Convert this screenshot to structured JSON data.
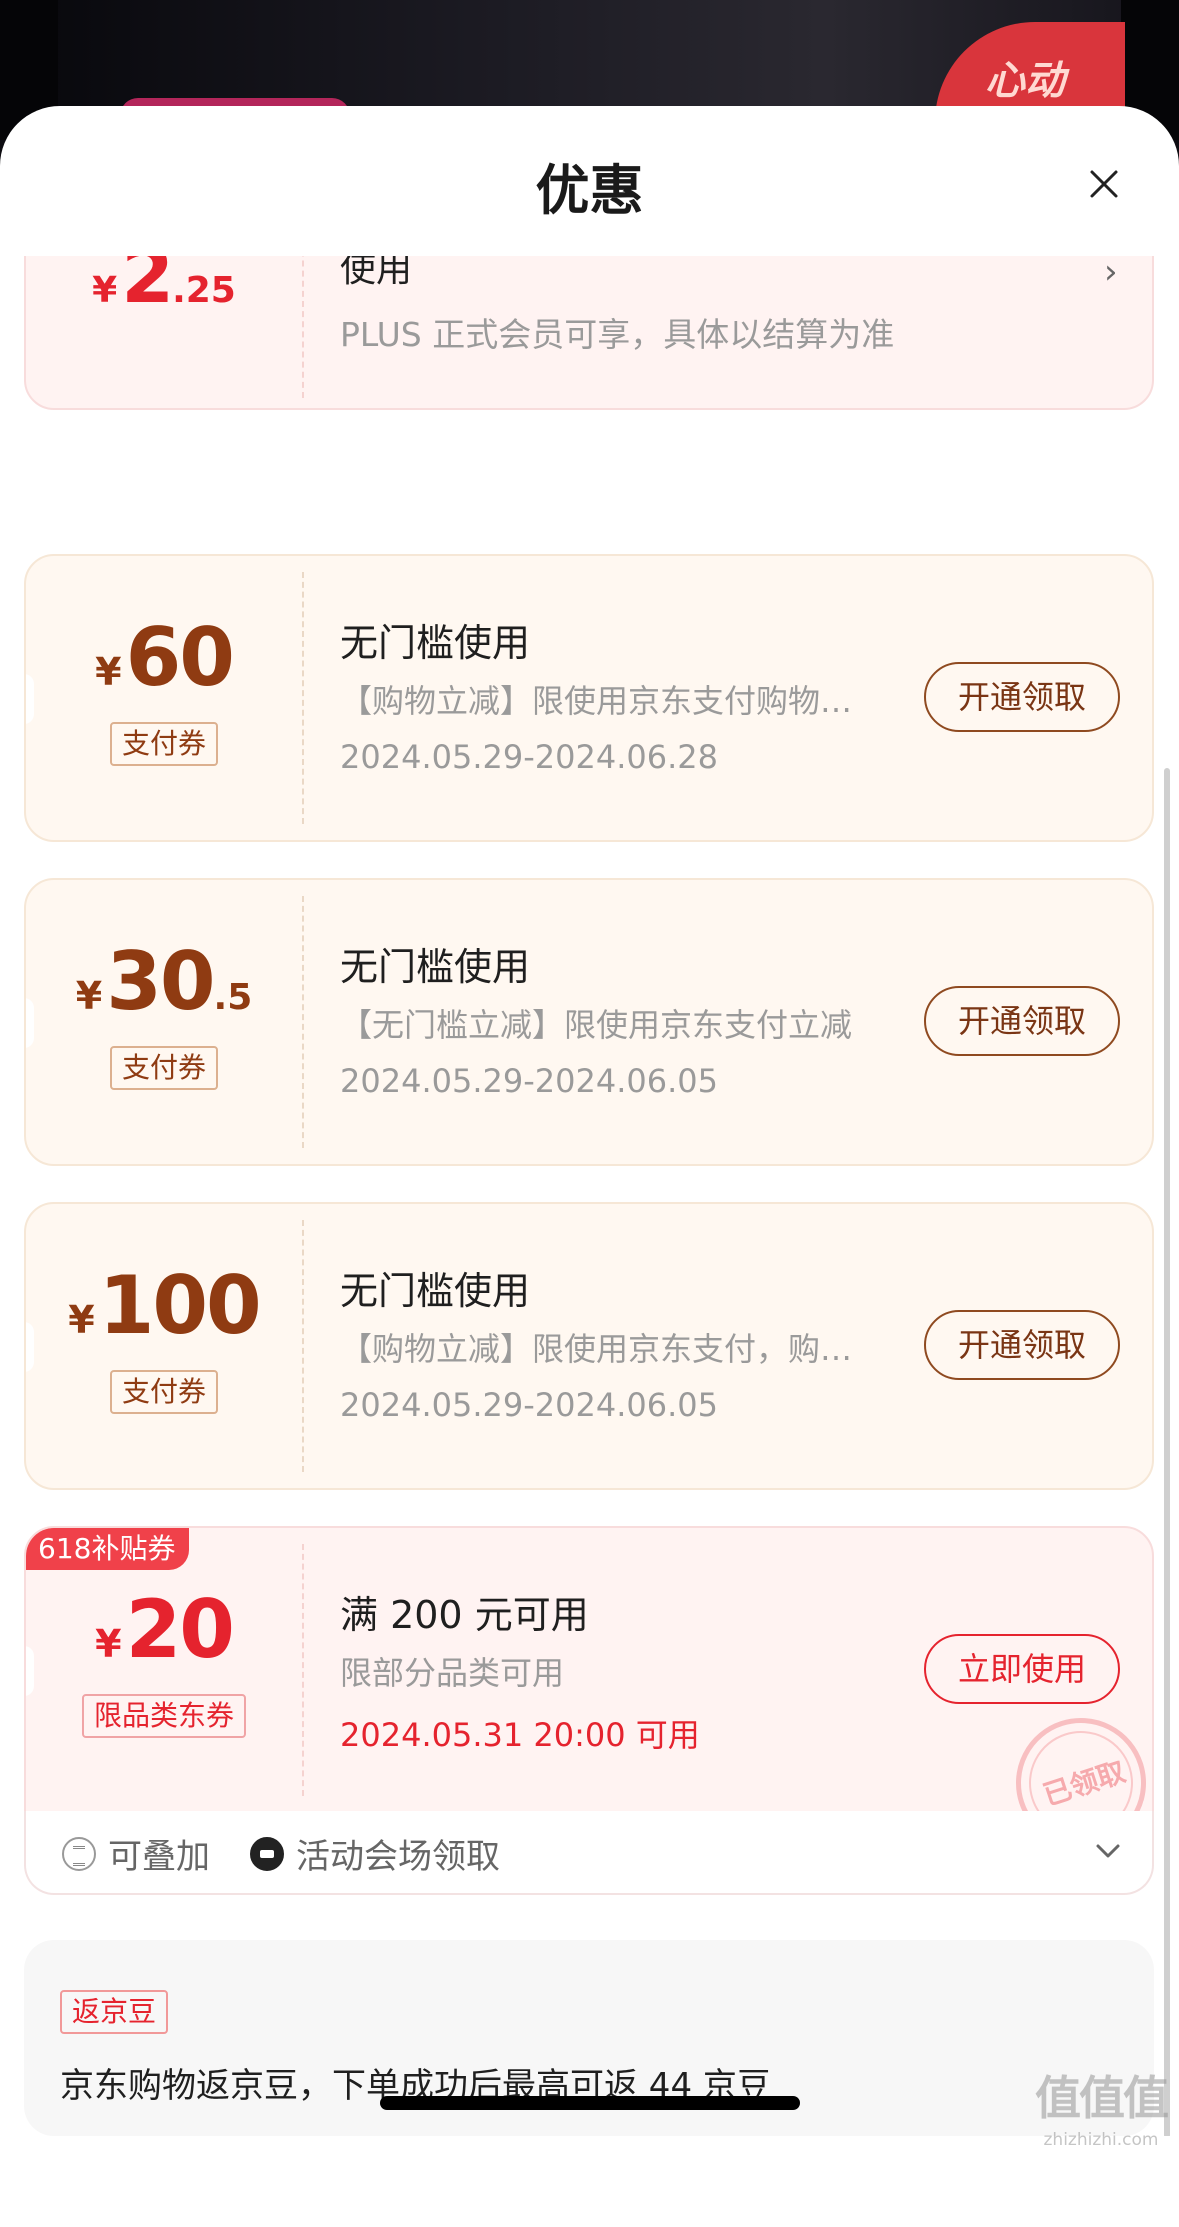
{
  "background": {
    "badge_text": "心动"
  },
  "sheet": {
    "title": "优惠"
  },
  "top_coupon": {
    "currency": "¥",
    "amount_int": "2",
    "amount_dec": ".25",
    "title": "使用",
    "desc": "PLUS 正式会员可享，具体以结算为准"
  },
  "coupons": [
    {
      "currency": "¥",
      "amount_int": "60",
      "amount_dec": "",
      "tag": "支付券",
      "title": "无门槛使用",
      "desc": "【购物立减】限使用京东支付购物立减",
      "date": "2024.05.29-2024.06.28",
      "button": "开通领取"
    },
    {
      "currency": "¥",
      "amount_int": "30",
      "amount_dec": ".5",
      "tag": "支付券",
      "title": "无门槛使用",
      "desc": "【无门槛立减】限使用京东支付立减",
      "date": "2024.05.29-2024.06.05",
      "button": "开通领取"
    },
    {
      "currency": "¥",
      "amount_int": "100",
      "amount_dec": "",
      "tag": "支付券",
      "title": "无门槛使用",
      "desc": "【购物立减】限使用京东支付，购物立减",
      "date": "2024.05.29-2024.06.05",
      "button": "开通领取"
    },
    {
      "badge": "618补贴券",
      "currency": "¥",
      "amount_int": "20",
      "amount_dec": "",
      "tag": "限品类东券",
      "title": "满 200 元可用",
      "desc": "限部分品类可用",
      "date": "2024.05.31 20:00 可用",
      "button": "立即使用",
      "stamp": "已领取",
      "footer": {
        "stackable": "可叠加",
        "source": "活动会场领取"
      }
    }
  ],
  "jingdou": {
    "tag": "返京豆",
    "text": "京东购物返京豆，下单成功后最高可返 44 京豆"
  },
  "watermark": {
    "logo": "值值值",
    "url": "zhizhizhi.com"
  },
  "colors": {
    "accent_red": "#e5232e",
    "brown": "#8f3b12",
    "cream_bg": "#fff8f1",
    "pink_bg": "#fff3f2"
  }
}
